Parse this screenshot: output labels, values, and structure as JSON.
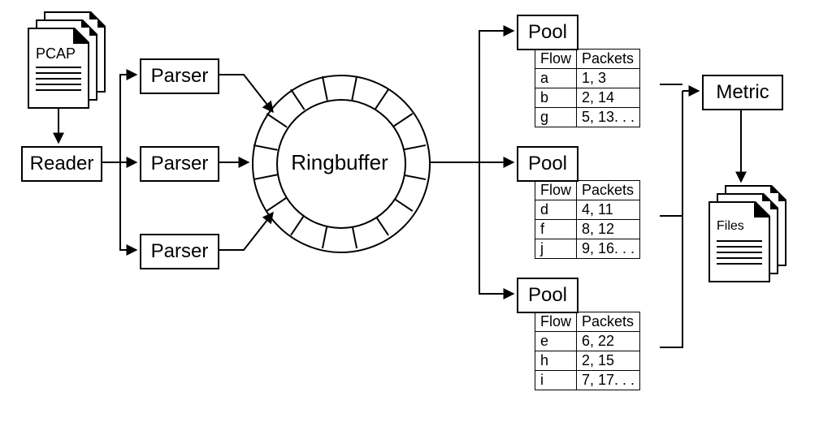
{
  "pcap": {
    "label": "PCAP"
  },
  "reader": {
    "label": "Reader"
  },
  "parsers": [
    {
      "label": "Parser"
    },
    {
      "label": "Parser"
    },
    {
      "label": "Parser"
    }
  ],
  "ringbuffer": {
    "label": "Ringbuffer",
    "segments": 16
  },
  "pools": [
    {
      "label": "Pool",
      "header_flow": "Flow",
      "header_packets": "Packets",
      "rows": [
        {
          "flow": "a",
          "packets": "1, 3"
        },
        {
          "flow": "b",
          "packets": "2, 14"
        },
        {
          "flow": "g",
          "packets": "5, 13. . ."
        }
      ]
    },
    {
      "label": "Pool",
      "header_flow": "Flow",
      "header_packets": "Packets",
      "rows": [
        {
          "flow": "d",
          "packets": "4, 11"
        },
        {
          "flow": "f",
          "packets": "8, 12"
        },
        {
          "flow": "j",
          "packets": "9, 16. . ."
        }
      ]
    },
    {
      "label": "Pool",
      "header_flow": "Flow",
      "header_packets": "Packets",
      "rows": [
        {
          "flow": "e",
          "packets": "6, 22"
        },
        {
          "flow": "h",
          "packets": "2, 15"
        },
        {
          "flow": "i",
          "packets": "7, 17. . ."
        }
      ]
    }
  ],
  "metric": {
    "label": "Metric"
  },
  "outfiles": {
    "label": "Files"
  }
}
